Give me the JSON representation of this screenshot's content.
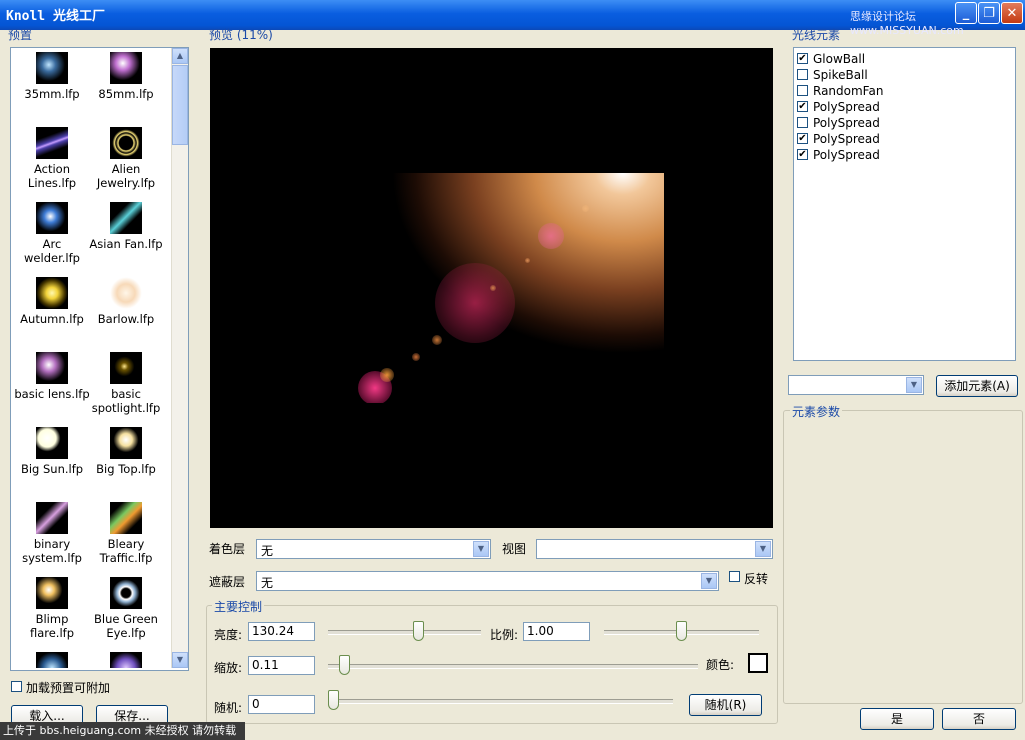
{
  "window": {
    "title": "Knoll 光线工厂",
    "watermark": "思缘设计论坛 www.MISSYUAN.com",
    "minimize": "_",
    "restore": "❐",
    "close": "✕"
  },
  "presets": {
    "label": "预置",
    "items": [
      {
        "label": "35mm.lfp",
        "icon": "flare-thumb"
      },
      {
        "label": "85mm.lfp",
        "icon": "flare-thumb"
      },
      {
        "label": "Action Lines.lfp",
        "icon": "flare-thumb"
      },
      {
        "label": "Alien Jewelry.lfp",
        "icon": "flare-thumb"
      },
      {
        "label": "Arc welder.lfp",
        "icon": "flare-thumb"
      },
      {
        "label": "Asian Fan.lfp",
        "icon": "flare-thumb"
      },
      {
        "label": "Autumn.lfp",
        "icon": "flare-thumb"
      },
      {
        "label": "Barlow.lfp",
        "icon": "flare-thumb"
      },
      {
        "label": "basic lens.lfp",
        "icon": "flare-thumb"
      },
      {
        "label": "basic spotlight.lfp",
        "icon": "flare-thumb"
      },
      {
        "label": "Big Sun.lfp",
        "icon": "flare-thumb"
      },
      {
        "label": "Big Top.lfp",
        "icon": "flare-thumb"
      },
      {
        "label": "binary system.lfp",
        "icon": "flare-thumb"
      },
      {
        "label": "Bleary Traffic.lfp",
        "icon": "flare-thumb"
      },
      {
        "label": "Blimp flare.lfp",
        "icon": "flare-thumb"
      },
      {
        "label": "Blue Green Eye.lfp",
        "icon": "flare-thumb"
      }
    ],
    "append_checkbox": {
      "label": "加载预置可附加",
      "checked": false
    },
    "load_button": "载入...",
    "save_button": "保存..."
  },
  "preview": {
    "label": "预览 (11%)"
  },
  "layers": {
    "color_label": "着色层",
    "color_value": "无",
    "view_label": "视图",
    "view_value": "",
    "mask_label": "遮蔽层",
    "mask_value": "无",
    "invert_label": "反转",
    "invert_checked": false
  },
  "main_controls": {
    "label": "主要控制",
    "brightness_label": "亮度:",
    "brightness_value": "130.24",
    "brightness_slider": 0.6,
    "ratio_label": "比例:",
    "ratio_value": "1.00",
    "ratio_slider": 0.5,
    "scale_label": "缩放:",
    "scale_value": "0.11",
    "scale_slider": 0.03,
    "color_label": "颜色:",
    "color_swatch": "#ffffff",
    "random_label": "随机:",
    "random_value": "0",
    "random_slider": 0.0,
    "random_button": "随机(R)"
  },
  "elements": {
    "label": "光线元素",
    "items": [
      {
        "name": "GlowBall",
        "checked": true
      },
      {
        "name": "SpikeBall",
        "checked": false
      },
      {
        "name": "RandomFan",
        "checked": false
      },
      {
        "name": "PolySpread",
        "checked": true
      },
      {
        "name": "PolySpread",
        "checked": false
      },
      {
        "name": "PolySpread",
        "checked": true
      },
      {
        "name": "PolySpread",
        "checked": true
      }
    ],
    "add_select_value": "",
    "add_button": "添加元素(A)",
    "params_label": "元素参数"
  },
  "footer": {
    "ok_button": "是",
    "cancel_button": "否",
    "bottom_watermark": "上传于 bbs.heiguang.com  未经授权 请勿转载"
  }
}
